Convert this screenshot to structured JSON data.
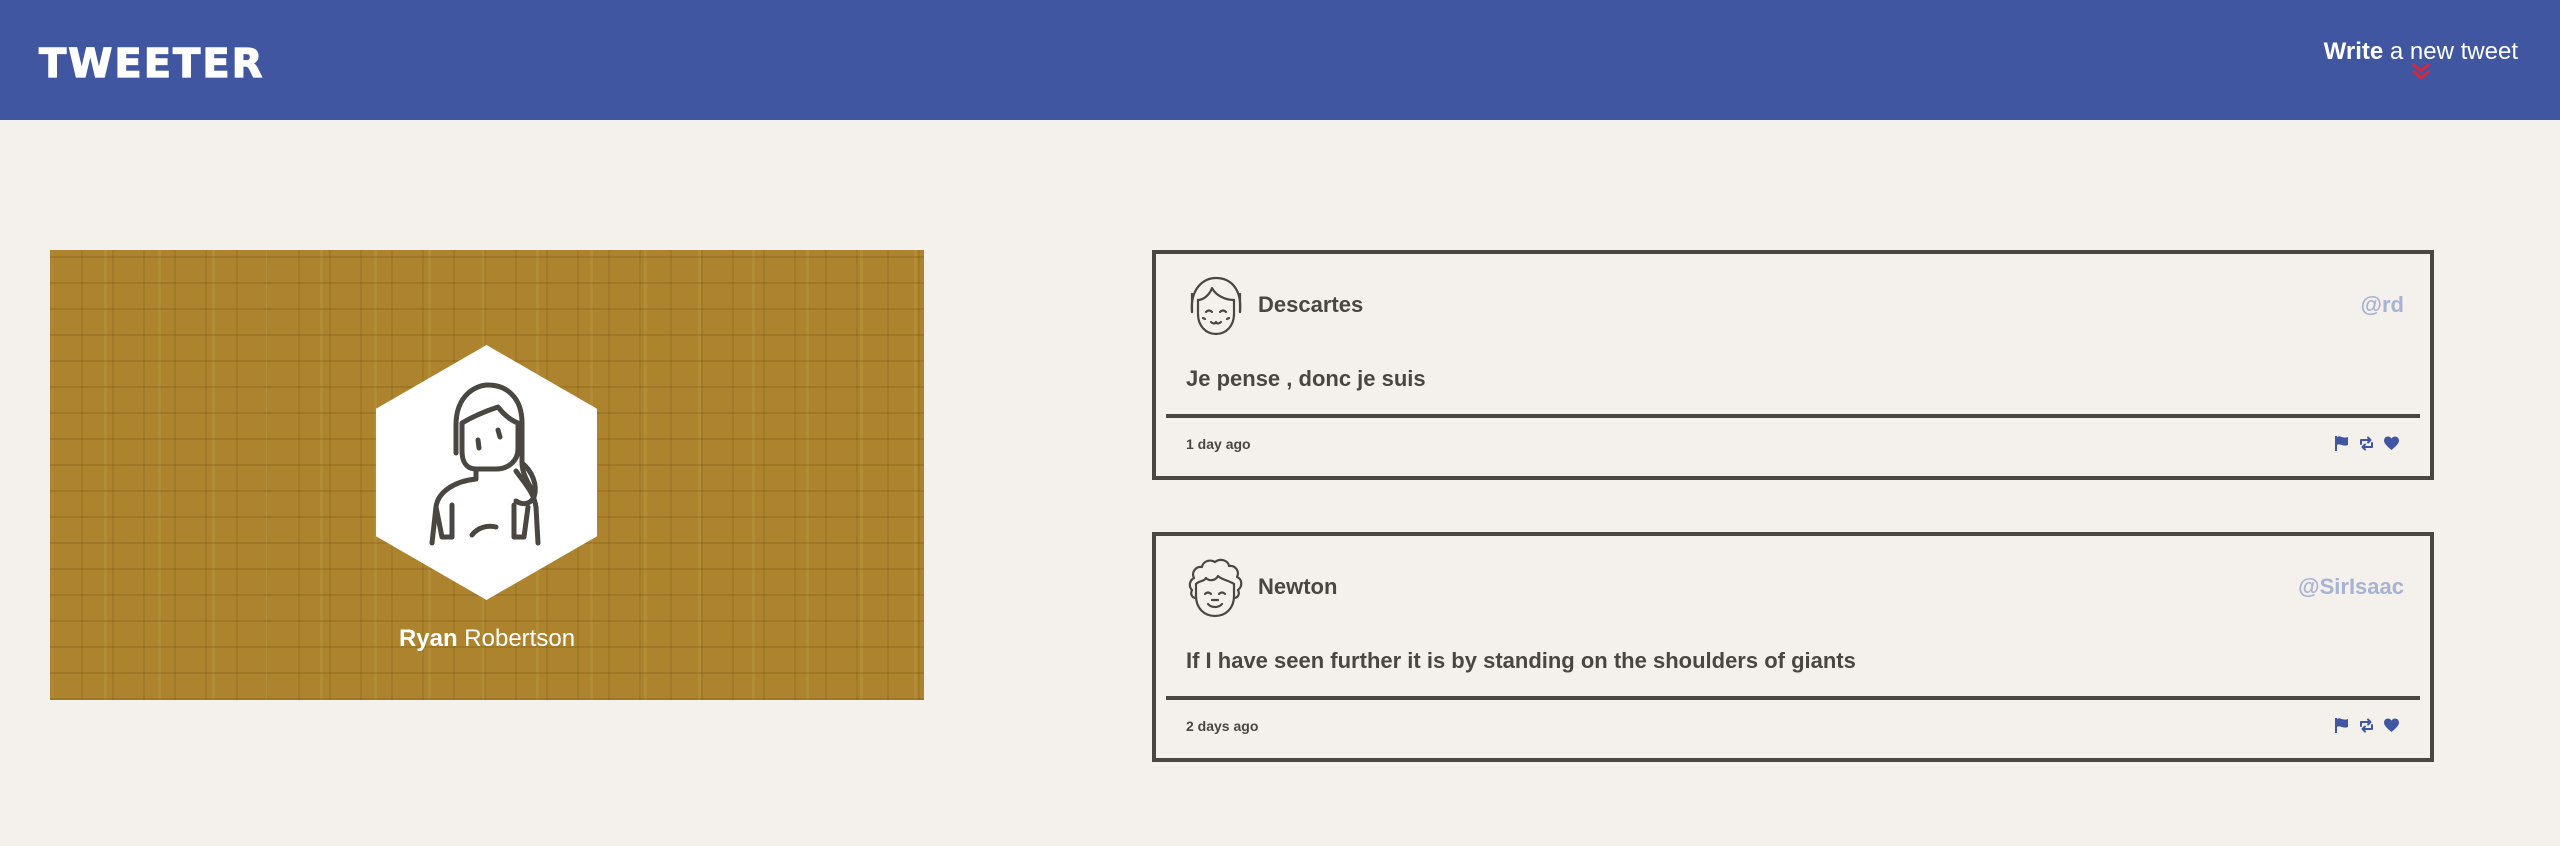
{
  "navbar": {
    "brand": "TWEETER",
    "compose_bold": "Write",
    "compose_rest": " a new tweet",
    "compose_arrow_icon": "double-chevron-down-icon",
    "colors": {
      "background": "#4056a1",
      "arrow": "#d7263d"
    }
  },
  "profile": {
    "first_name": "Ryan",
    "last_name": " Robertson",
    "avatar_icon": "woman-avatar-icon",
    "background_color": "#ad842d"
  },
  "tweets": [
    {
      "author": "Descartes",
      "handle": "@rd",
      "avatar_icon": "girl-avatar-icon",
      "text": "Je pense , donc je suis",
      "time": "1 day ago",
      "actions": [
        "flag-icon",
        "retweet-icon",
        "heart-icon"
      ]
    },
    {
      "author": "Newton",
      "handle": "@SirIsaac",
      "avatar_icon": "curly-hair-avatar-icon",
      "text": "If I have seen further it is by standing on the shoulders of giants",
      "time": "2 days ago",
      "actions": [
        "flag-icon",
        "retweet-icon",
        "heart-icon"
      ]
    }
  ],
  "colors": {
    "page_background": "#f4f1ec",
    "text": "#4a4743",
    "handle": "#a8b2d2",
    "action_icons": "#4056a1"
  }
}
